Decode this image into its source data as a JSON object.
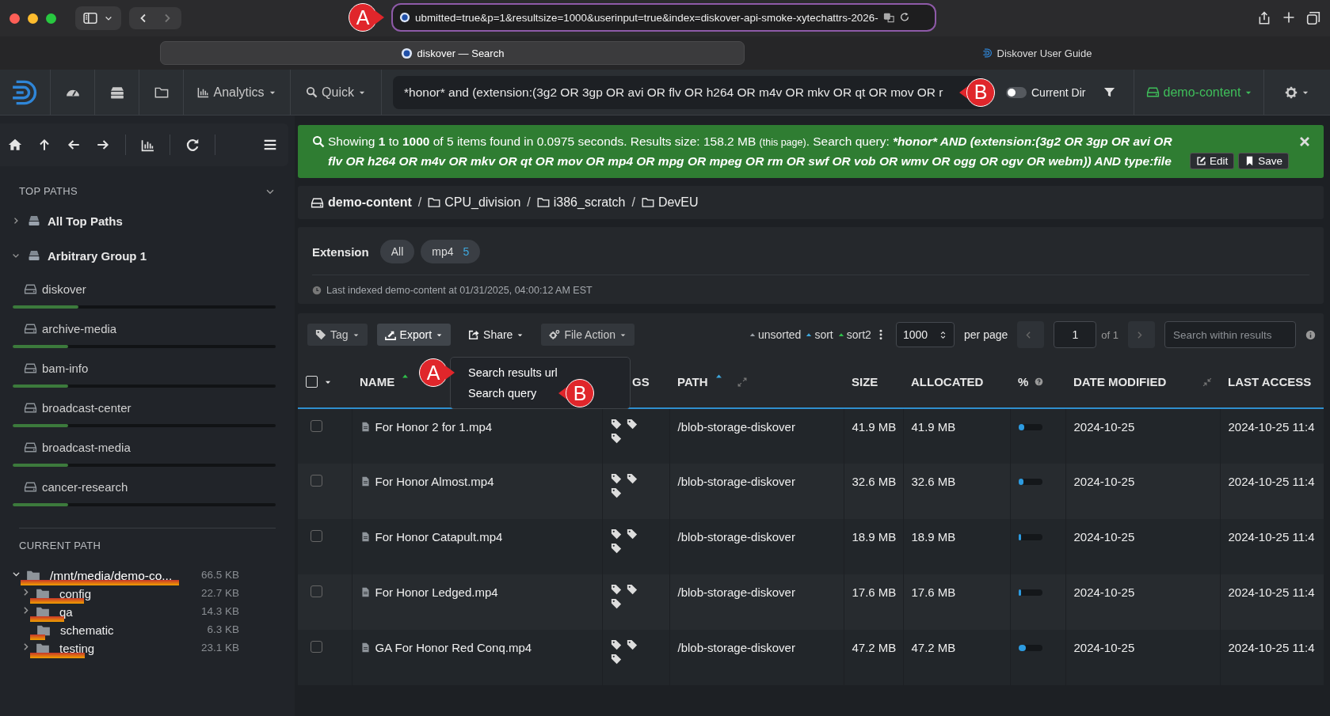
{
  "browser": {
    "url": "ubmitted=true&p=1&resultsize=1000&userinput=true&index=diskover-api-smoke-xytechattrs-2026-",
    "url_callout": "A",
    "tabs": [
      {
        "label": "diskover — Search",
        "selected": true
      },
      {
        "label": "Diskover User Guide",
        "selected": false
      }
    ]
  },
  "navbar": {
    "menus": [
      "Analytics",
      "Quick"
    ],
    "search": {
      "value": "*honor* and (extension:(3g2 OR 3gp OR avi OR flv OR h264 OR m4v OR mkv OR qt OR mov OR r",
      "callout": "B"
    },
    "current_dir": {
      "label": "Current Dir",
      "on": false
    },
    "index": "demo-content"
  },
  "sidebar": {
    "top_paths": {
      "title": "TOP PATHS",
      "groups": [
        {
          "label": "All Top Paths",
          "expanded": false
        },
        {
          "label": "Arbitrary Group 1",
          "expanded": true,
          "children": [
            {
              "label": "diskover",
              "level": 0.25
            },
            {
              "label": "archive-media",
              "level": 0.21
            },
            {
              "label": "bam-info",
              "level": 0.21
            },
            {
              "label": "broadcast-center",
              "level": 0.21
            },
            {
              "label": "broadcast-media",
              "level": 0.21
            },
            {
              "label": "cancer-research",
              "level": 0.21
            }
          ]
        }
      ]
    },
    "current_path": {
      "title": "CURRENT PATH",
      "tree": [
        {
          "label": "/mnt/media/demo-co...",
          "size": "66.5 KB",
          "kind": "branch",
          "expanded": true,
          "children": [
            {
              "label": "config",
              "size": "22.7 KB",
              "kind": "branch",
              "expanded": false
            },
            {
              "label": "qa",
              "size": "14.3 KB",
              "kind": "branch",
              "expanded": false
            },
            {
              "label": "schematic",
              "size": "6.3 KB",
              "kind": "leaf",
              "expanded": false
            },
            {
              "label": "testing",
              "size": "23.1 KB",
              "kind": "branch",
              "expanded": false
            }
          ]
        }
      ]
    }
  },
  "alert": {
    "summary": "Showing **1** to **1000** of 5 items found in 0.0975 seconds. Results size: 158.2 MB",
    "note": "(this page)",
    "query_label": ". Search query:",
    "query": "*honor* AND (extension:(3g2 OR 3gp OR avi OR flv OR h264 OR m4v OR mkv OR qt OR mov OR mp4 OR mpg OR mpeg OR rm OR swf OR vob OR wmv OR ogg OR ogv OR webm)) AND type:file",
    "buttons": [
      "Edit",
      "Save"
    ]
  },
  "breadcrumb": {
    "separator": "/",
    "items": [
      {
        "label": "demo-content",
        "kind": "drive"
      },
      {
        "label": "CPU_division",
        "kind": "folder"
      },
      {
        "label": "i386_scratch",
        "kind": "folder"
      },
      {
        "label": "DevEU",
        "kind": "folder"
      }
    ]
  },
  "filters": {
    "label": "Extension",
    "chips": [
      {
        "label": "All"
      },
      {
        "label": "mp4",
        "count": "5"
      }
    ],
    "last_indexed": "Last indexed demo-content at 01/31/2025, 04:00:12 AM EST"
  },
  "toolbar": {
    "actions": [
      {
        "label": "Tag",
        "highlighted": false
      },
      {
        "label": "Export",
        "highlighted": true
      },
      {
        "label": "Share",
        "highlighted": false,
        "menu": [
          {
            "label": "Search results url",
            "callout": "A"
          },
          {
            "label": "Search query",
            "callout": "B"
          }
        ]
      },
      {
        "label": "File Action",
        "highlighted": false
      }
    ],
    "sorts": [
      {
        "label": "unsorted",
        "color": "#9aa0a6"
      },
      {
        "label": "sort",
        "color": "#3ea8de"
      },
      {
        "label": "sort2",
        "color": "#2fbf4a"
      }
    ],
    "per_page": "1000",
    "per_page_label": "per page",
    "page": "1",
    "page_count": "of 1",
    "search_placeholder": "Search within results"
  },
  "table": {
    "select_all": {
      "checked": false
    },
    "columns": [
      {
        "label": "NAME",
        "sorted": true
      },
      {
        "label": "GS",
        "sorted": false
      },
      {
        "label": "PATH",
        "sorted": true
      },
      {
        "label": "SIZE",
        "sorted": false
      },
      {
        "label": "ALLOCATED",
        "sorted": false
      },
      {
        "label": "%",
        "sorted": false
      },
      {
        "label": "DATE MODIFIED",
        "sorted": false
      },
      {
        "label": "LAST ACCESS",
        "sorted": false
      }
    ],
    "rows": [
      {
        "checked": false,
        "name": "For Honor 2 for 1.mp4",
        "path": "/blob-storage-diskover",
        "size": "41.9 MB",
        "allocated": "41.9 MB",
        "level": 0.26,
        "modified": "2024-10-25",
        "accessed": "2024-10-25 11:4"
      },
      {
        "checked": false,
        "name": "For Honor Almost.mp4",
        "path": "/blob-storage-diskover",
        "size": "32.6 MB",
        "allocated": "32.6 MB",
        "level": 0.21,
        "modified": "2024-10-25",
        "accessed": "2024-10-25 11:4"
      },
      {
        "checked": false,
        "name": "For Honor Catapult.mp4",
        "path": "/blob-storage-diskover",
        "size": "18.9 MB",
        "allocated": "18.9 MB",
        "level": 0.12,
        "modified": "2024-10-25",
        "accessed": "2024-10-25 11:4"
      },
      {
        "checked": false,
        "name": "For Honor Ledged.mp4",
        "path": "/blob-storage-diskover",
        "size": "17.6 MB",
        "allocated": "17.6 MB",
        "level": 0.11,
        "modified": "2024-10-25",
        "accessed": "2024-10-25 11:4"
      },
      {
        "checked": false,
        "name": "GA For Honor Red Conq.mp4",
        "path": "/blob-storage-diskover",
        "size": "47.2 MB",
        "allocated": "47.2 MB",
        "level": 0.3,
        "modified": "2024-10-25",
        "accessed": "2024-10-25 11:4"
      }
    ]
  }
}
